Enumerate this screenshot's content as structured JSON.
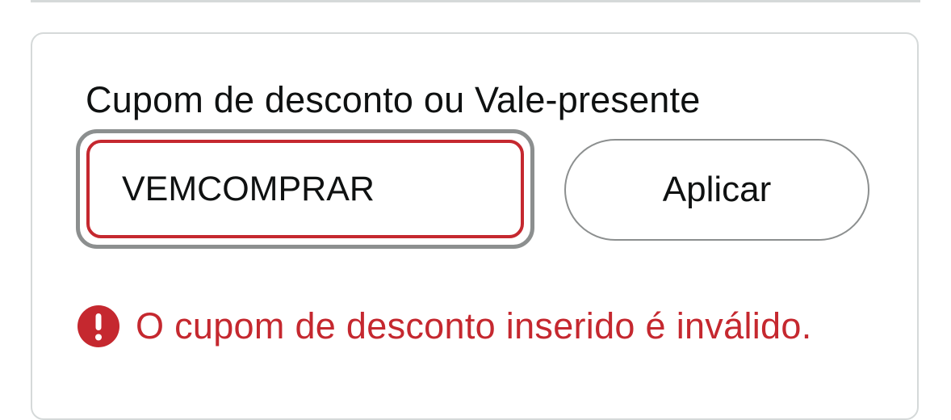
{
  "coupon_section": {
    "title": "Cupom de desconto ou Vale-presente",
    "input_value": "VEMCOMPRAR",
    "apply_label": "Aplicar",
    "error_message": "O cupom de desconto inserido é inválido.",
    "error_icon": "exclamation-circle-icon"
  },
  "colors": {
    "error": "#c5282f",
    "text": "#0f1111",
    "border": "#8c8f8f",
    "card_border": "#d5d9d9"
  }
}
